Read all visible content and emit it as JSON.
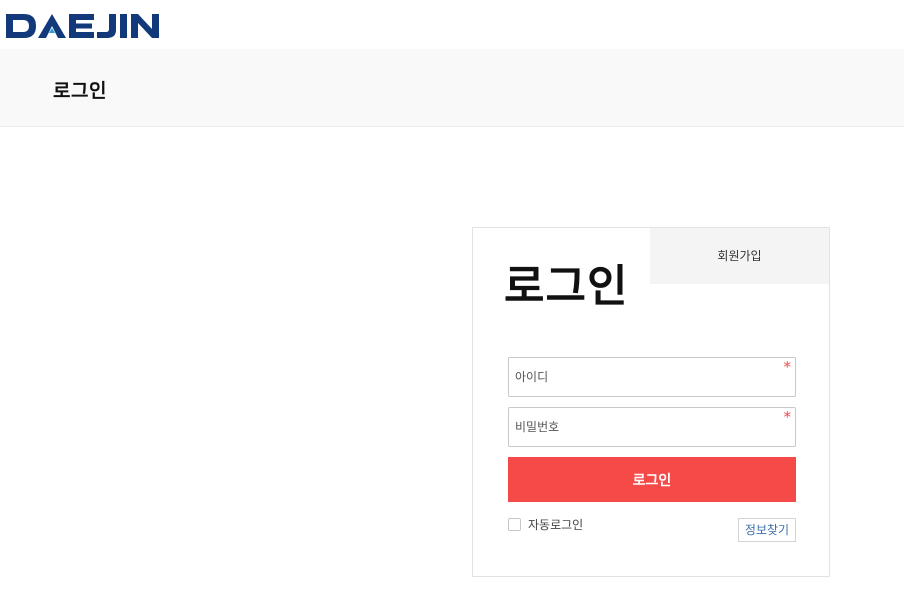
{
  "brand": {
    "logo_text": "DAEJIN",
    "color": "#123a7a",
    "accent": "#2aa0d8"
  },
  "header": {
    "title": "로그인"
  },
  "login": {
    "heading": "로그인",
    "register_tab": "회원가입",
    "id_placeholder": "아이디",
    "pw_placeholder": "비밀번호",
    "required_mark": "*",
    "submit_label": "로그인",
    "auto_login_label": "자동로그인",
    "auto_login_checked": false,
    "find_info_label": "정보찾기",
    "button_color": "#f64a48"
  }
}
